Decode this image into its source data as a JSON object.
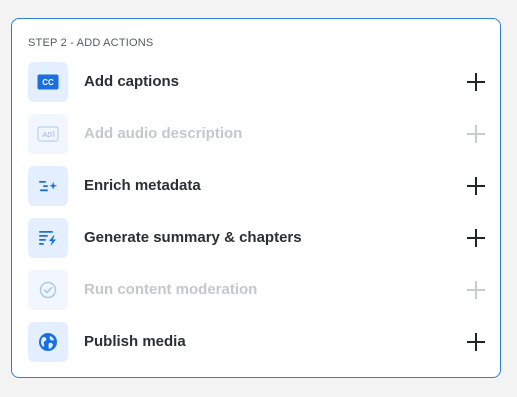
{
  "panel": {
    "step_title": "STEP 2 - ADD ACTIONS"
  },
  "actions": [
    {
      "label": "Add captions",
      "icon": "cc-icon",
      "icon_text": "CC",
      "enabled": true
    },
    {
      "label": "Add audio description",
      "icon": "audio-description-icon",
      "icon_text": "AD",
      "enabled": false
    },
    {
      "label": "Enrich metadata",
      "icon": "sparkle-list-icon",
      "enabled": true
    },
    {
      "label": "Generate summary & chapters",
      "icon": "summary-bolt-icon",
      "enabled": true
    },
    {
      "label": "Run content moderation",
      "icon": "check-circle-icon",
      "enabled": false
    },
    {
      "label": "Publish media",
      "icon": "globe-icon",
      "enabled": true
    }
  ],
  "colors": {
    "accent": "#1a6fe0",
    "border": "#2f7fd8",
    "icon_bg": "#e3efff",
    "disabled_text": "#c4c7cc"
  }
}
